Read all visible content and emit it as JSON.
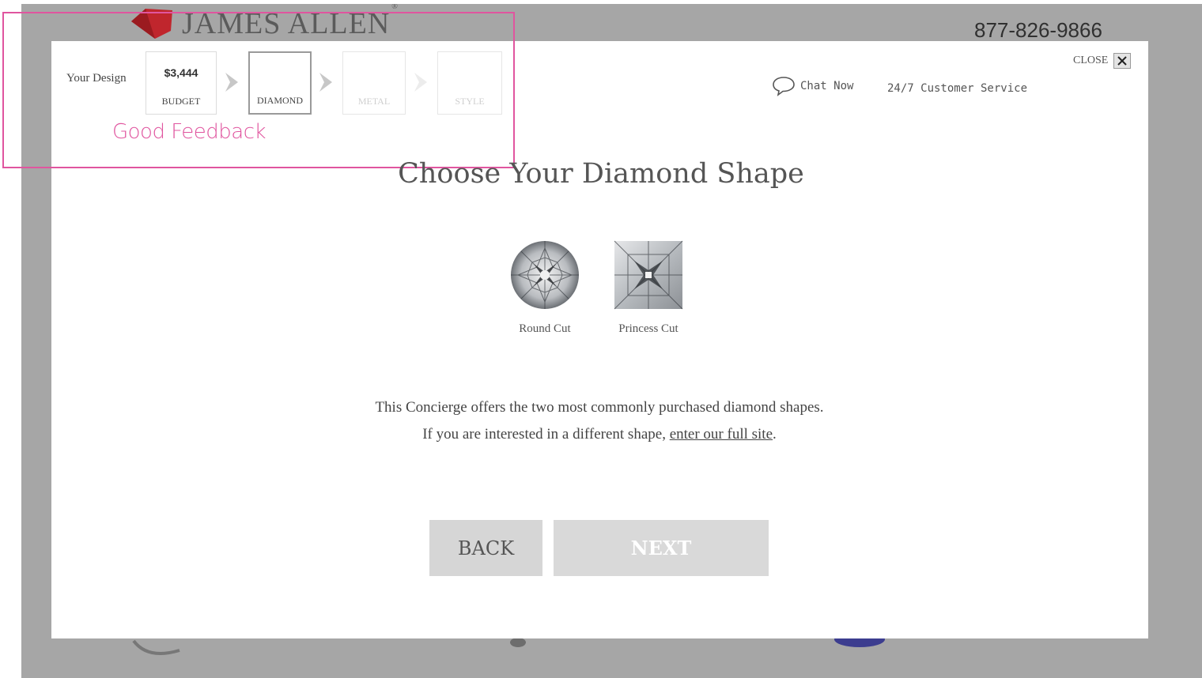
{
  "background": {
    "logo_text": "JAMES ALLEN",
    "logo_reg": "®",
    "phone": "877-826-9866"
  },
  "progress": {
    "label": "Your Design",
    "steps": [
      {
        "value": "$3,444",
        "label": "BUDGET",
        "state": "done"
      },
      {
        "value": "",
        "label": "DIAMOND",
        "state": "current"
      },
      {
        "value": "",
        "label": "METAL",
        "state": "disabled"
      },
      {
        "value": "",
        "label": "STYLE",
        "state": "disabled"
      }
    ]
  },
  "annotation": {
    "text": "Good Feedback",
    "color": "#e0559f"
  },
  "header": {
    "chat_label": "Chat Now",
    "service_label": "24/7 Customer Service",
    "close_label": "CLOSE"
  },
  "main": {
    "title": "Choose Your Diamond Shape",
    "shapes": [
      {
        "label": "Round Cut",
        "icon": "round-diamond-icon"
      },
      {
        "label": "Princess Cut",
        "icon": "princess-diamond-icon"
      }
    ],
    "info_line1": "This Concierge offers the two most commonly purchased diamond shapes.",
    "info_line2_prefix": "If you are interested in a different shape, ",
    "info_link": "enter our full site",
    "info_line2_suffix": "."
  },
  "buttons": {
    "back": "BACK",
    "next": "NEXT"
  }
}
